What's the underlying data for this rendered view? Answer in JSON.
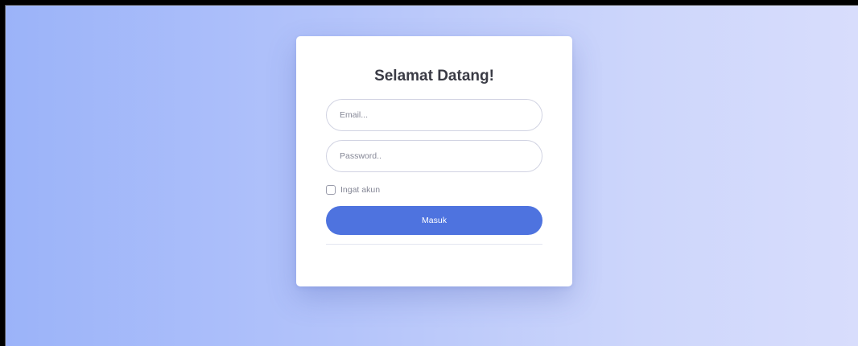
{
  "login": {
    "title": "Selamat Datang!",
    "email_placeholder": "Email...",
    "password_placeholder": "Password..",
    "remember_label": "Ingat akun",
    "remember_checked": false,
    "submit_label": "Masuk"
  },
  "colors": {
    "primary": "#4e73df",
    "background_start": "#9bb3f9",
    "background_end": "#d8ddfc",
    "title_text": "#3a3b45"
  }
}
